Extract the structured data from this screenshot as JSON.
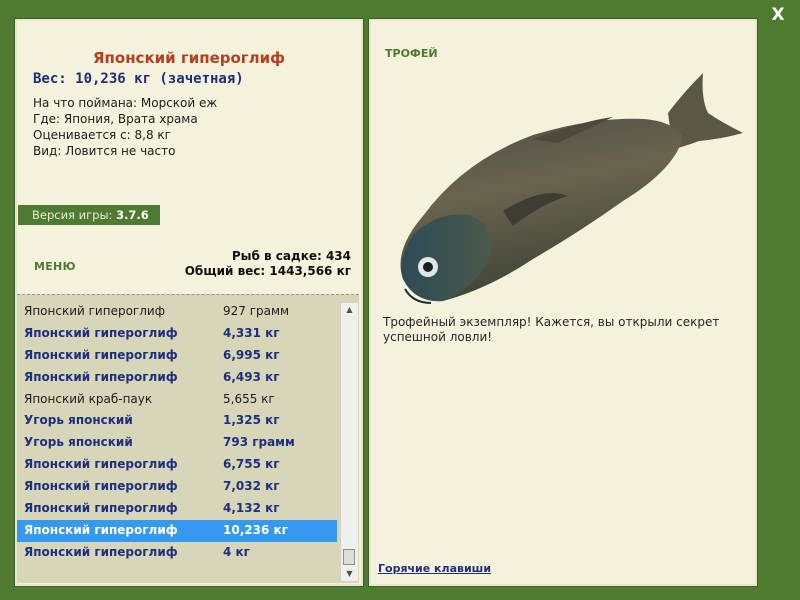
{
  "window": {
    "close_label": "X"
  },
  "fish_info": {
    "name": "Японский гипероглиф",
    "weight_line": "Вес: 10,236 кг (зачетная)",
    "bait": "На что поймана: Морской еж",
    "location": "Где: Япония, Врата храма",
    "rated_from": "Оценивается с: 8,8 кг",
    "rarity": "Вид: Ловится не часто"
  },
  "version": {
    "label": "Версия игры:",
    "number": "3.7.6"
  },
  "menu": {
    "label": "МЕНЮ"
  },
  "keepnet": {
    "fish_count": "Рыб в садке: 434",
    "total_weight": "Общий вес: 1443,566 кг"
  },
  "catch_list": [
    {
      "name": "Японский гипероглиф",
      "weight": "927 грамм",
      "bold": false,
      "selected": false
    },
    {
      "name": "Японский гипероглиф",
      "weight": "4,331 кг",
      "bold": true,
      "selected": false
    },
    {
      "name": "Японский гипероглиф",
      "weight": "6,995 кг",
      "bold": true,
      "selected": false
    },
    {
      "name": "Японский гипероглиф",
      "weight": "6,493 кг",
      "bold": true,
      "selected": false
    },
    {
      "name": "Японский краб-паук",
      "weight": "5,655 кг",
      "bold": false,
      "selected": false
    },
    {
      "name": "Угорь японский",
      "weight": "1,325 кг",
      "bold": true,
      "selected": false
    },
    {
      "name": "Угорь японский",
      "weight": "793 грамм",
      "bold": true,
      "selected": false
    },
    {
      "name": "Японский гипероглиф",
      "weight": "6,755 кг",
      "bold": true,
      "selected": false
    },
    {
      "name": "Японский гипероглиф",
      "weight": "7,032 кг",
      "bold": true,
      "selected": false
    },
    {
      "name": "Японский гипероглиф",
      "weight": "4,132 кг",
      "bold": true,
      "selected": false
    },
    {
      "name": "Японский гипероглиф",
      "weight": "10,236 кг",
      "bold": true,
      "selected": true
    },
    {
      "name": "Японский гипероглиф",
      "weight": "4 кг",
      "bold": true,
      "selected": false
    }
  ],
  "trophy_panel": {
    "badge": "ТРОФЕЙ",
    "fish_image": "fish-photo",
    "message": "Трофейный экземпляр! Кажется, вы открыли секрет успешной ловли!",
    "hotkeys_link": "Горячие клавиши"
  },
  "colors": {
    "background": "#4e7b30",
    "panel": "#f4f1dd",
    "list_background": "#d8d6b8",
    "title_red": "#b5401f",
    "accent_blue": "#1f2f7e",
    "selection": "#3599ef"
  }
}
